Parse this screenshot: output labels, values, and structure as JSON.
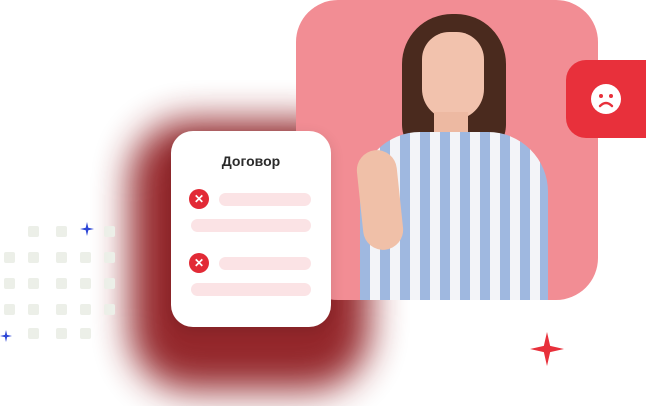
{
  "document_card": {
    "title": "Договор",
    "items": [
      {
        "status_icon": "close-icon"
      },
      {
        "status_icon": "close-icon"
      }
    ]
  },
  "badge": {
    "icon": "sad-face-icon",
    "color": "#e8303b"
  },
  "colors": {
    "accent": "#e8303b",
    "photo_bg": "#f28d94",
    "glow": "#8f1c20"
  },
  "decorations": [
    "dot-grid",
    "red-sparkle",
    "blue-sparkle"
  ]
}
